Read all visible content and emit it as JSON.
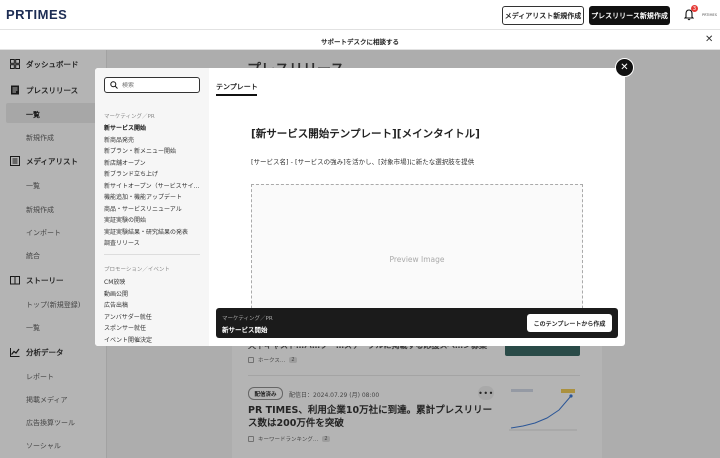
{
  "header": {
    "logo": "PRTIMES",
    "media_list_button": "メディアリスト新規作成",
    "press_release_button": "プレスリリース新規作成",
    "notification_count": "3",
    "user_label": "PRTIMES"
  },
  "banner": {
    "text": "サポートデスクに相談する"
  },
  "sidebar": {
    "dashboard": "ダッシュボード",
    "press_release": "プレスリリース",
    "pr_list": "一覧",
    "pr_new": "新規作成",
    "media_list": "メディアリスト",
    "ml_list": "一覧",
    "ml_new": "新規作成",
    "ml_import": "インポート",
    "ml_merge": "統合",
    "story": "ストーリー",
    "story_top": "トップ(新規登録)",
    "story_list": "一覧",
    "analytics": "分析データ",
    "an_report": "レポート",
    "an_media": "掲載メディア",
    "an_ad": "広告換算ツール",
    "an_social": "ソーシャル"
  },
  "background": {
    "page_title": "プレスリリース",
    "frag_title": "天下キャスト…ハ…ブー…ステーブルに掲載する応援スペ…ン募集",
    "frag_tag": "ホークス…",
    "frag_count": "2",
    "status": "配信済み",
    "date": "配信日：2024.07.29 (月) 08:00",
    "article_title": "PR TIMES、利用企業10万社に到達。累計プレスリリース数は200万件を突破",
    "article_tag": "キーワードランキング…",
    "article_count": "2"
  },
  "modal": {
    "search_placeholder": "検索",
    "cat1": "マーケティング／PR",
    "items1": [
      "新サービス開始",
      "新商品発売",
      "新プラン・新メニュー開始",
      "新店舗オープン",
      "新ブランド立ち上げ",
      "新サイトオープン（サービスサイ…",
      "機能追加・機能アップデート",
      "商品・サービスリニューアル",
      "実証実験の開始",
      "実証実験結果・研究結果の発表",
      "調査リリース"
    ],
    "cat2": "プロモーション／イベント",
    "items2": [
      "CM放映",
      "動画公開",
      "広告出稿",
      "アンバサダー就任",
      "スポンサー就任",
      "イベント開催決定"
    ],
    "tab": "テンプレート",
    "template_title": "[新サービス開始テンプレート][メインタイトル]",
    "template_sub": "[サービス名] - [サービスの強み]を活かし、[対象市場]に新たな選択肢を提供",
    "preview": "Preview Image"
  },
  "action_bar": {
    "category": "マーケティング／PR",
    "name": "新サービス開始",
    "button": "このテンプレートから作成"
  }
}
